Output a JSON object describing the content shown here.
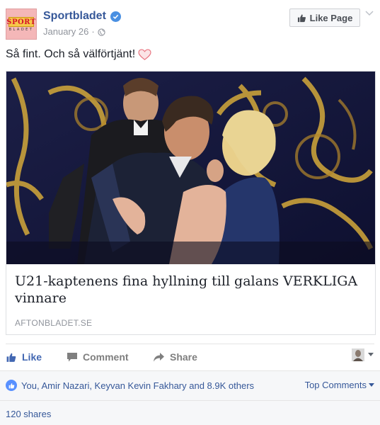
{
  "post": {
    "page_name": "Sportbladet",
    "date": "January 26",
    "separator": "·",
    "like_page_label": "Like Page",
    "text": "Så fint. Och så välförtjänt!",
    "logo_top": "SPORT",
    "logo_bottom": "BLADET"
  },
  "link": {
    "title": "U21-kaptenens fina hyllning till galans VERKLIGA vinnare",
    "domain": "AFTONBLADET.SE"
  },
  "actions": {
    "like": "Like",
    "comment": "Comment",
    "share": "Share"
  },
  "reactions": {
    "summary": "You, Amir Nazari, Keyvan Kevin Fakhary and 8.9K others",
    "top_comments": "Top Comments"
  },
  "shares": {
    "count": "120 shares"
  },
  "colors": {
    "link_blue": "#365899",
    "like_blue": "#4267b2",
    "verified_blue": "#4a90e2"
  }
}
